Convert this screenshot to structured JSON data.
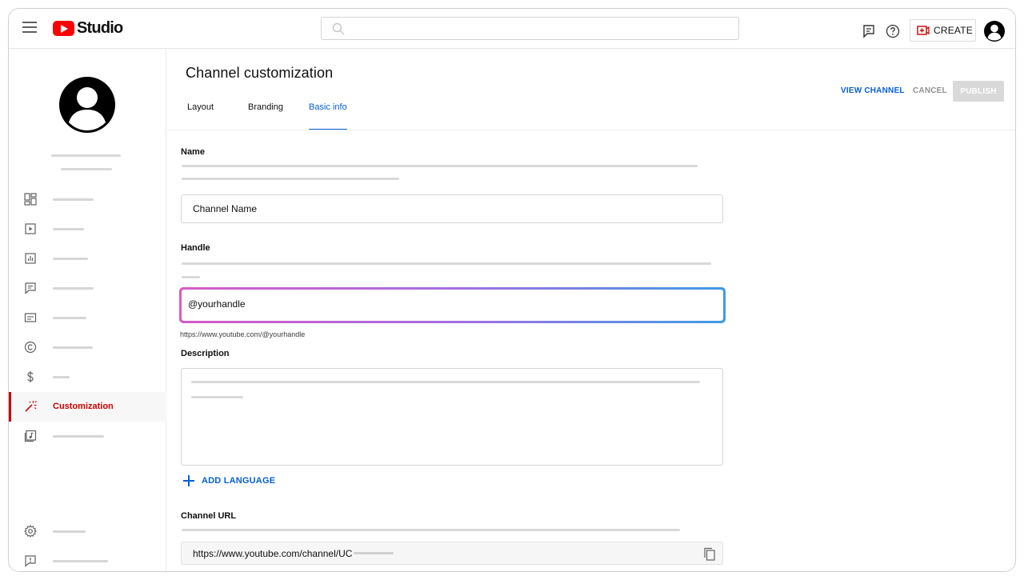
{
  "app": {
    "logo_text": "Studio",
    "brand_color": "#ff0000"
  },
  "header": {
    "search_placeholder": "",
    "create_label": "CREATE"
  },
  "sidebar": {
    "active_item": {
      "label": "Customization",
      "icon": "magic-wand-icon"
    },
    "items": [
      {
        "icon": "dashboard-icon"
      },
      {
        "icon": "content-icon"
      },
      {
        "icon": "analytics-icon"
      },
      {
        "icon": "comments-icon"
      },
      {
        "icon": "subtitles-icon"
      },
      {
        "icon": "copyright-icon"
      },
      {
        "icon": "earn-icon"
      },
      {
        "icon": "magic-wand-icon",
        "label": "Customization"
      },
      {
        "icon": "audio-library-icon"
      },
      {
        "icon": "settings-icon"
      },
      {
        "icon": "feedback-icon"
      }
    ]
  },
  "main": {
    "title": "Channel customization",
    "tabs": [
      {
        "label": "Layout"
      },
      {
        "label": "Branding"
      },
      {
        "label": "Basic info",
        "active": true
      }
    ],
    "actions": {
      "view_channel": "VIEW CHANNEL",
      "cancel": "CANCEL",
      "publish": "PUBLISH"
    },
    "name": {
      "label": "Name",
      "value": "Channel Name"
    },
    "handle": {
      "label": "Handle",
      "value": "@yourhandle",
      "helper_url": "https://www.youtube.com/@yourhandle"
    },
    "description": {
      "label": "Description"
    },
    "add_language": "ADD LANGUAGE",
    "channel_url": {
      "label": "Channel URL",
      "value": "https://www.youtube.com/channel/UC"
    }
  },
  "colors": {
    "accent_blue": "#065fd4",
    "active_red": "#cc0000",
    "handle_gradient_start": "#d65bc6",
    "handle_gradient_end": "#3f9be6"
  }
}
